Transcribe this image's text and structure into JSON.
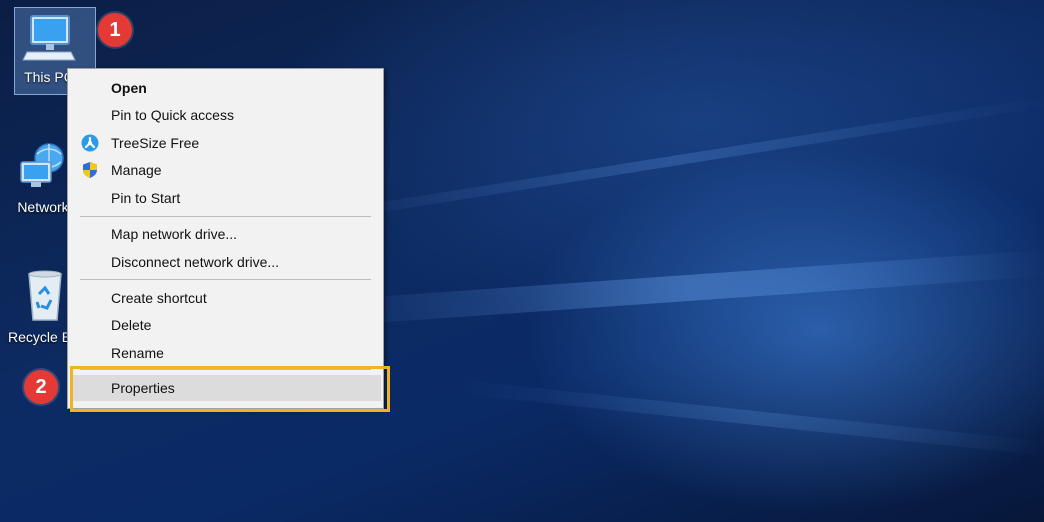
{
  "desktop": {
    "icons": [
      {
        "name": "This PC",
        "icon": "computer-icon"
      },
      {
        "name": "Network",
        "icon": "network-icon"
      },
      {
        "name": "Recycle Bin",
        "icon": "recycle-bin-icon"
      }
    ]
  },
  "badges": {
    "step1": "1",
    "step2": "2"
  },
  "context_menu": {
    "group1": [
      {
        "label": "Open",
        "icon": ""
      },
      {
        "label": "Pin to Quick access",
        "icon": ""
      },
      {
        "label": "TreeSize Free",
        "icon": "treesize-icon"
      },
      {
        "label": "Manage",
        "icon": "shield-icon"
      },
      {
        "label": "Pin to Start",
        "icon": ""
      }
    ],
    "group2": [
      {
        "label": "Map network drive..."
      },
      {
        "label": "Disconnect network drive..."
      }
    ],
    "group3": [
      {
        "label": "Create shortcut"
      },
      {
        "label": "Delete"
      },
      {
        "label": "Rename"
      }
    ],
    "group4": [
      {
        "label": "Properties"
      }
    ]
  },
  "colors": {
    "highlight_border": "#f0b323",
    "badge": "#e53935",
    "menu_bg": "#f2f2f2"
  }
}
